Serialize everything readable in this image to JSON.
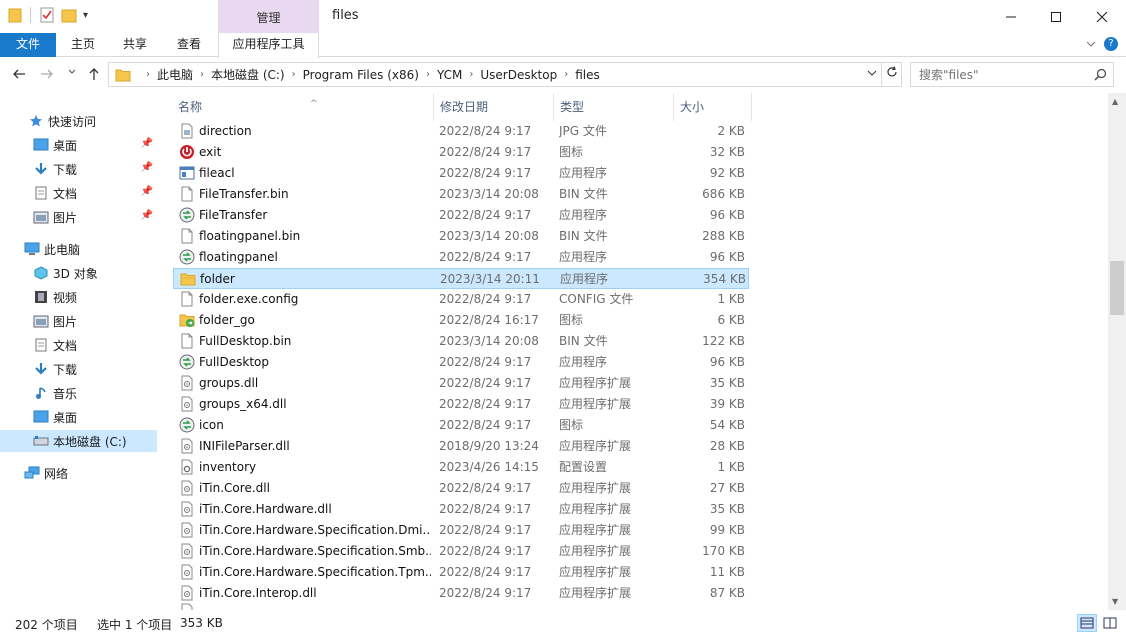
{
  "window": {
    "title": "files",
    "context_group": "管理",
    "controls": {
      "minimize": "—",
      "maximize": "☐",
      "close": "✕"
    }
  },
  "ribbon": {
    "tabs": [
      "文件",
      "主页",
      "共享",
      "查看"
    ],
    "context_tab": "应用程序工具"
  },
  "address": {
    "crumbs": [
      "此电脑",
      "本地磁盘 (C:)",
      "Program Files (x86)",
      "YCM",
      "UserDesktop",
      "files"
    ],
    "search_placeholder": "搜索\"files\""
  },
  "nav": {
    "quick_access": "快速访问",
    "quick_items": [
      "桌面",
      "下载",
      "文档",
      "图片"
    ],
    "this_pc": "此电脑",
    "pc_items": [
      "3D 对象",
      "视频",
      "图片",
      "文档",
      "下载",
      "音乐",
      "桌面",
      "本地磁盘 (C:)"
    ],
    "network": "网络"
  },
  "columns": {
    "name": "名称",
    "date": "修改日期",
    "type": "类型",
    "size": "大小"
  },
  "files": [
    {
      "name": "direction",
      "date": "2022/8/24 9:17",
      "type": "JPG 文件",
      "size": "2 KB",
      "icon": "image-file-icon"
    },
    {
      "name": "exit",
      "date": "2022/8/24 9:17",
      "type": "图标",
      "size": "32 KB",
      "icon": "power-icon"
    },
    {
      "name": "fileacl",
      "date": "2022/8/24 9:17",
      "type": "应用程序",
      "size": "92 KB",
      "icon": "app-window-icon"
    },
    {
      "name": "FileTransfer.bin",
      "date": "2023/3/14 20:08",
      "type": "BIN 文件",
      "size": "686 KB",
      "icon": "blank-file-icon"
    },
    {
      "name": "FileTransfer",
      "date": "2022/8/24 9:17",
      "type": "应用程序",
      "size": "96 KB",
      "icon": "app-arrows-icon"
    },
    {
      "name": "floatingpanel.bin",
      "date": "2023/3/14 20:08",
      "type": "BIN 文件",
      "size": "288 KB",
      "icon": "blank-file-icon"
    },
    {
      "name": "floatingpanel",
      "date": "2022/8/24 9:17",
      "type": "应用程序",
      "size": "96 KB",
      "icon": "app-arrows-icon"
    },
    {
      "name": "folder",
      "date": "2023/3/14 20:11",
      "type": "应用程序",
      "size": "354 KB",
      "icon": "folder-icon",
      "selected": true
    },
    {
      "name": "folder.exe.config",
      "date": "2022/8/24 9:17",
      "type": "CONFIG 文件",
      "size": "1 KB",
      "icon": "blank-file-icon"
    },
    {
      "name": "folder_go",
      "date": "2022/8/24 16:17",
      "type": "图标",
      "size": "6 KB",
      "icon": "folder-go-icon"
    },
    {
      "name": "FullDesktop.bin",
      "date": "2023/3/14 20:08",
      "type": "BIN 文件",
      "size": "122 KB",
      "icon": "blank-file-icon"
    },
    {
      "name": "FullDesktop",
      "date": "2022/8/24 9:17",
      "type": "应用程序",
      "size": "96 KB",
      "icon": "app-arrows-icon"
    },
    {
      "name": "groups.dll",
      "date": "2022/8/24 9:17",
      "type": "应用程序扩展",
      "size": "35 KB",
      "icon": "dll-file-icon"
    },
    {
      "name": "groups_x64.dll",
      "date": "2022/8/24 9:17",
      "type": "应用程序扩展",
      "size": "39 KB",
      "icon": "dll-file-icon"
    },
    {
      "name": "icon",
      "date": "2022/8/24 9:17",
      "type": "图标",
      "size": "54 KB",
      "icon": "app-arrows-icon"
    },
    {
      "name": "INIFileParser.dll",
      "date": "2018/9/20 13:24",
      "type": "应用程序扩展",
      "size": "28 KB",
      "icon": "dll-file-icon"
    },
    {
      "name": "inventory",
      "date": "2023/4/26 14:15",
      "type": "配置设置",
      "size": "1 KB",
      "icon": "config-file-icon"
    },
    {
      "name": "iTin.Core.dll",
      "date": "2022/8/24 9:17",
      "type": "应用程序扩展",
      "size": "27 KB",
      "icon": "dll-file-icon"
    },
    {
      "name": "iTin.Core.Hardware.dll",
      "date": "2022/8/24 9:17",
      "type": "应用程序扩展",
      "size": "35 KB",
      "icon": "dll-file-icon"
    },
    {
      "name": "iTin.Core.Hardware.Specification.Dmi...",
      "date": "2022/8/24 9:17",
      "type": "应用程序扩展",
      "size": "99 KB",
      "icon": "dll-file-icon"
    },
    {
      "name": "iTin.Core.Hardware.Specification.Smb...",
      "date": "2022/8/24 9:17",
      "type": "应用程序扩展",
      "size": "170 KB",
      "icon": "dll-file-icon"
    },
    {
      "name": "iTin.Core.Hardware.Specification.Tpm...",
      "date": "2022/8/24 9:17",
      "type": "应用程序扩展",
      "size": "11 KB",
      "icon": "dll-file-icon"
    },
    {
      "name": "iTin.Core.Interop.dll",
      "date": "2022/8/24 9:17",
      "type": "应用程序扩展",
      "size": "87 KB",
      "icon": "dll-file-icon"
    }
  ],
  "status": {
    "count": "202 个项目",
    "selected": "选中 1 个项目",
    "size": "353 KB"
  },
  "colors": {
    "accent": "#1979ca",
    "selection": "#cce8ff",
    "selection_border": "#99d1ff",
    "context": "#e8d8f0"
  }
}
